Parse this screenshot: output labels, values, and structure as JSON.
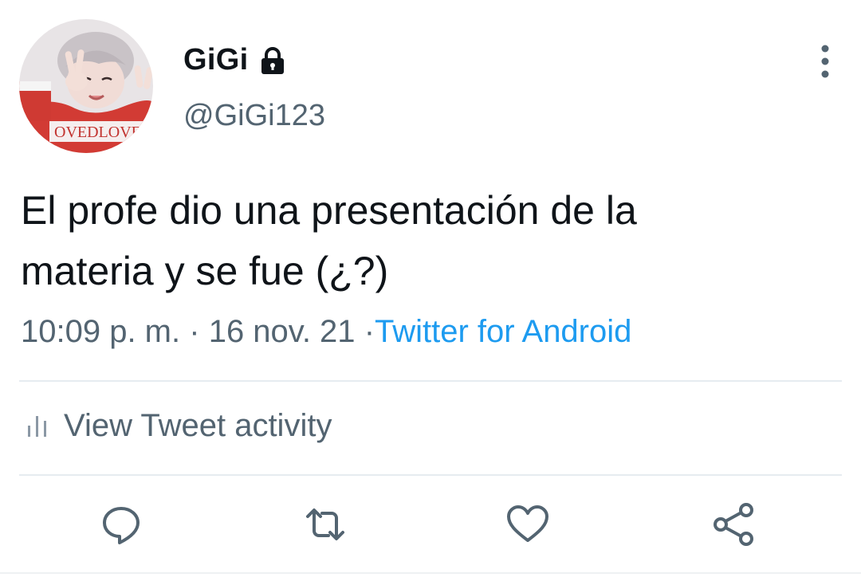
{
  "tweet": {
    "display_name": "GiGi",
    "handle": "@GiGi123",
    "text_lines": [
      "El profe dio una presentación de la",
      "materia y se fue (¿?)"
    ],
    "time": "10:09 p. m.",
    "separator": "·",
    "date": "16 nov. 21",
    "source": "Twitter for Android",
    "activity_label": "View Tweet activity",
    "avatar_shirt_text": "OVEDLOVE"
  },
  "icons": {
    "lock": "lock-icon",
    "more": "more-vertical-icon",
    "activity": "bar-chart-icon",
    "reply": "reply-icon",
    "retweet": "retweet-icon",
    "like": "heart-icon",
    "share": "share-icon"
  },
  "colors": {
    "text": "#0f1419",
    "secondary": "#536471",
    "link": "#1d9bf0",
    "icon": "#536471",
    "divider": "#e6ecf0"
  }
}
